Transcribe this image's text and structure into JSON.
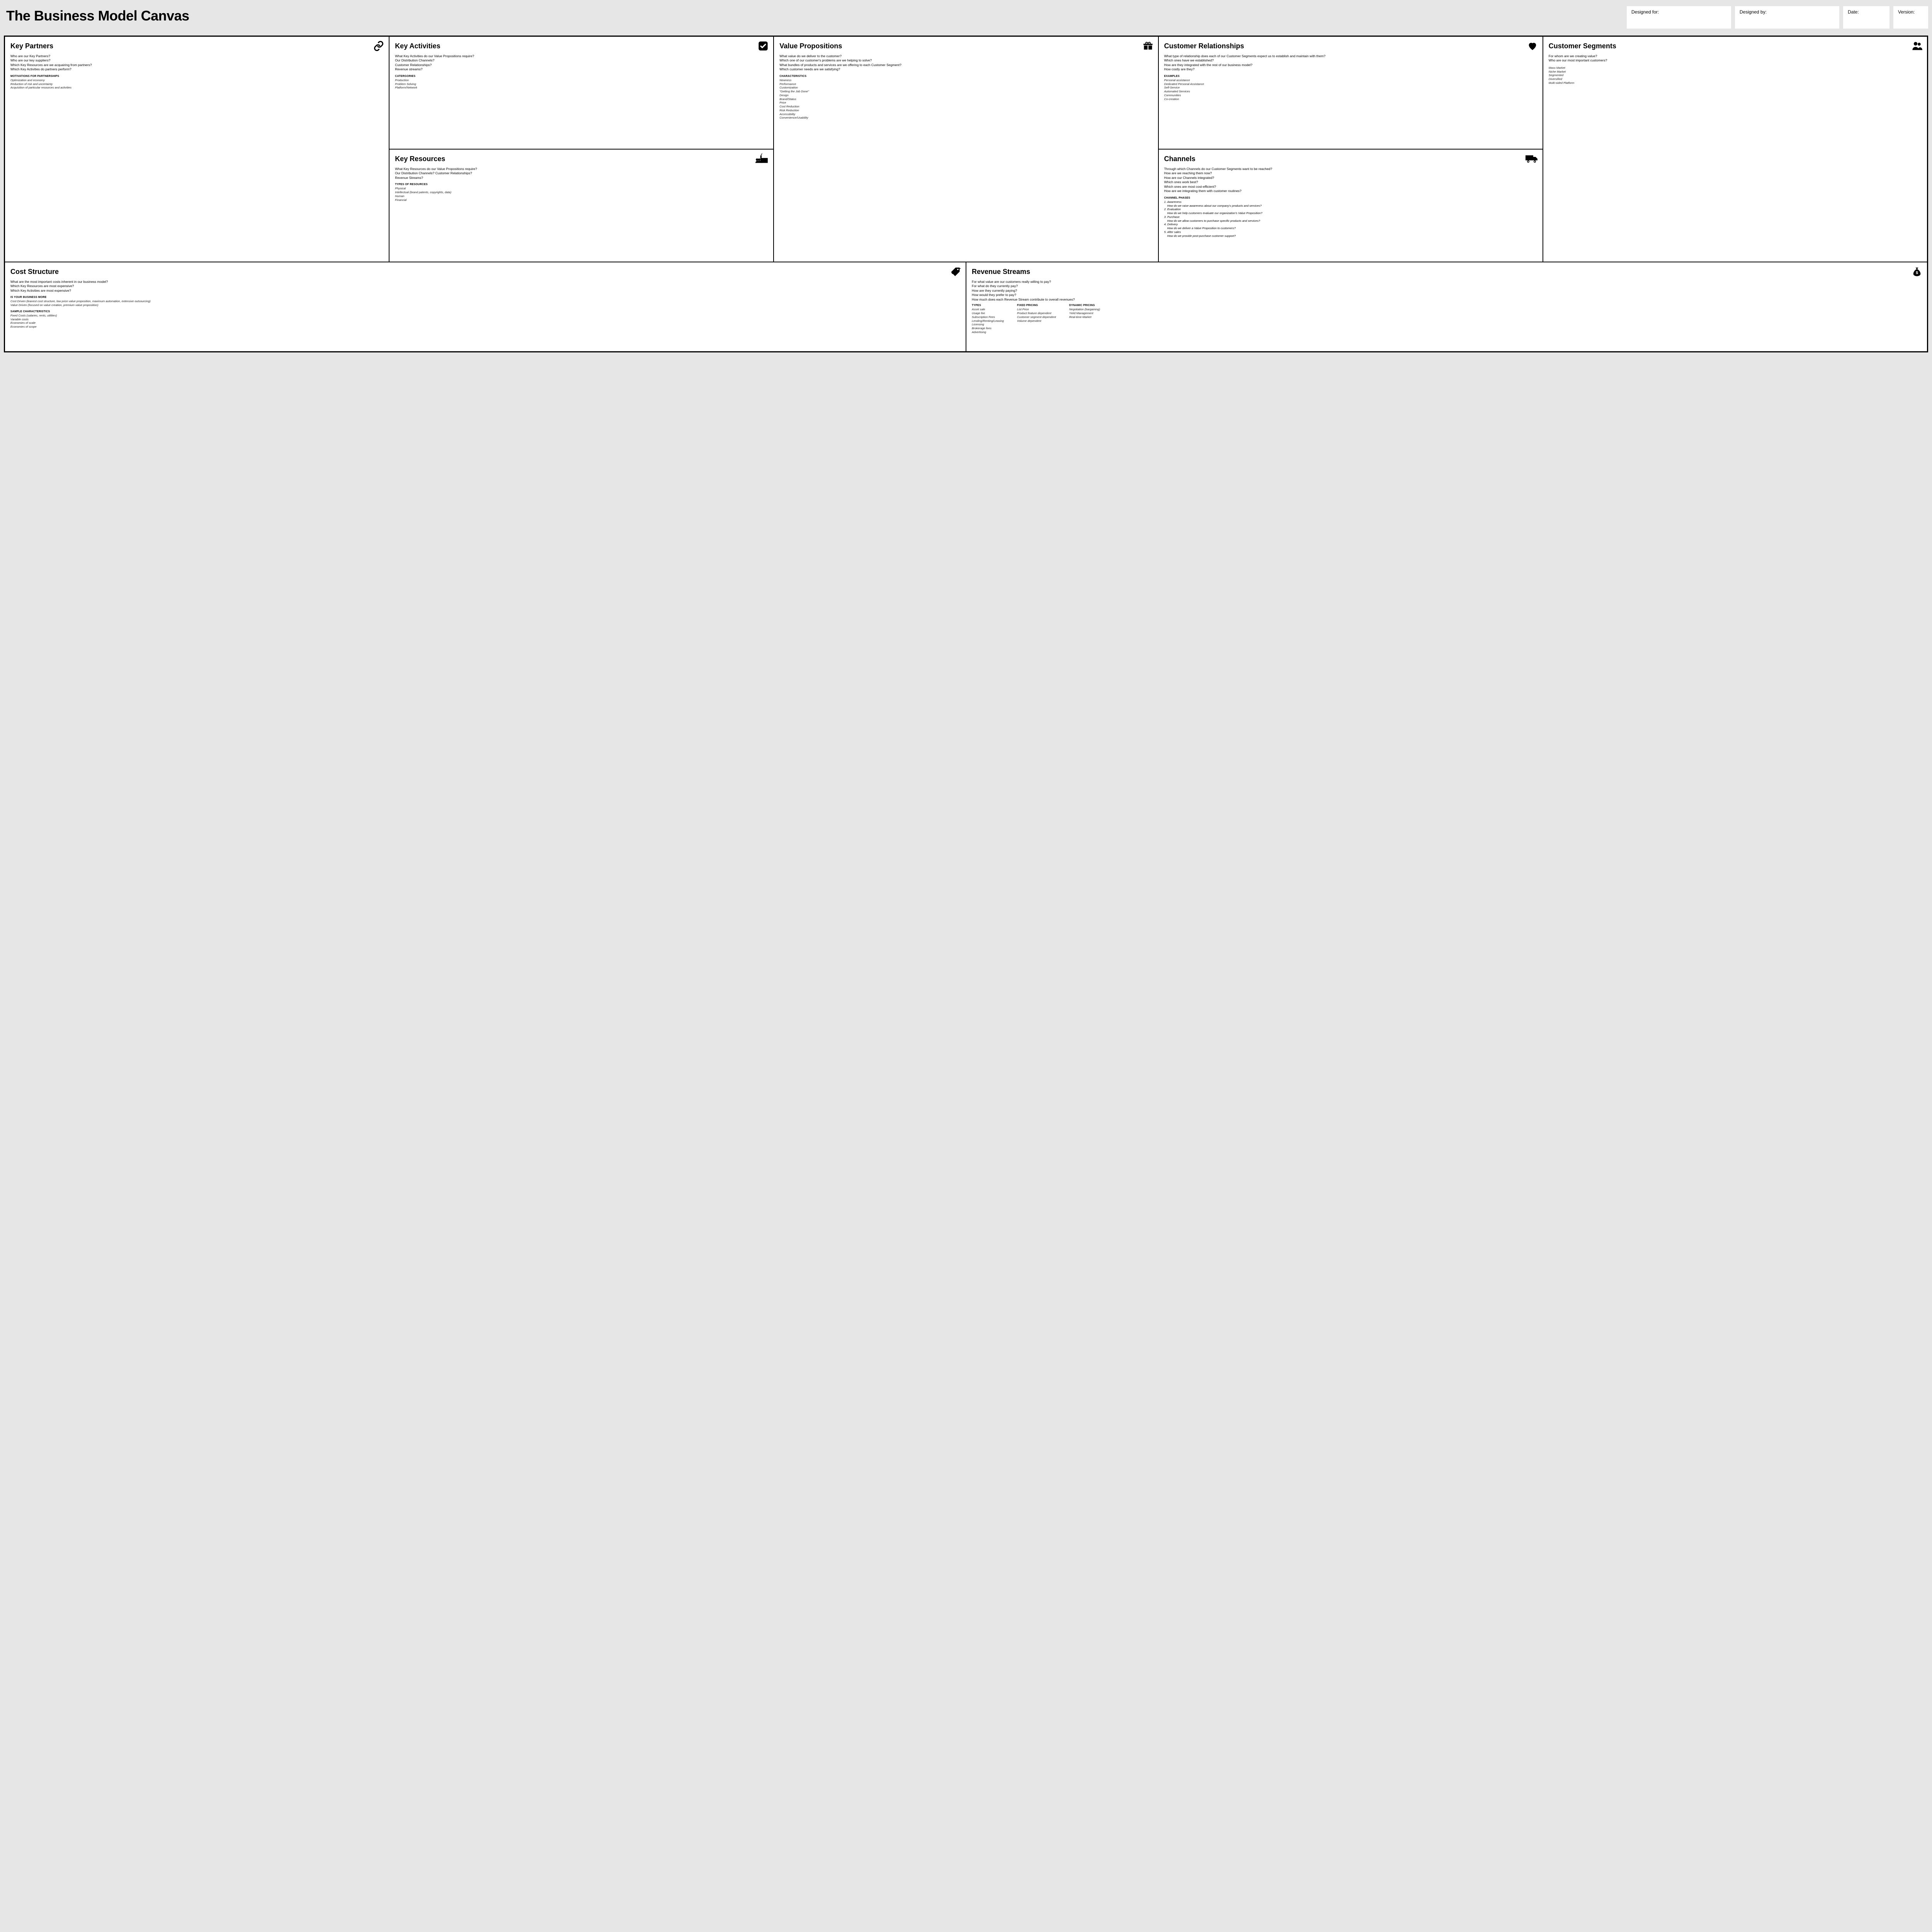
{
  "header": {
    "title": "The Business Model Canvas",
    "designed_for": "Designed for:",
    "designed_by": "Designed by:",
    "date": "Date:",
    "version": "Version:"
  },
  "kp": {
    "title": "Key Partners",
    "q1": "Who are our Key Partners?",
    "q2": "Who are our key suppliers?",
    "q3": "Which Key Resources are we acquairing from partners?",
    "q4": "Which Key Activities do partners perform?",
    "sub": "motivations for partnerships",
    "i1": "Optimization and economy",
    "i2": "Reduction of risk and uncertainty",
    "i3": "Acquisition of particular resources and activities"
  },
  "ka": {
    "title": "Key Activities",
    "q1": "What Key Activities do our Value Propositions require?",
    "q2": "Our Distribution Channels?",
    "q3": "Customer Relationships?",
    "q4": "Revenue streams?",
    "sub": "catergories",
    "i1": "Production",
    "i2": "Problem Solving",
    "i3": "Platform/Network"
  },
  "kr": {
    "title": "Key Resources",
    "q1": "What Key Resources do our Value Propositions require?",
    "q2": "Our Distribution Channels? Customer Relationships?",
    "q3": "Revenue Streams?",
    "sub": "types of resources",
    "i1": "Physical",
    "i2": "Intellectual (brand patents, copyrights, data)",
    "i3": "Human",
    "i4": "Financial"
  },
  "vp": {
    "title": "Value Propositions",
    "q1": "What value do we deliver to the customer?",
    "q2": "Which one of our customer's problems are we helping to solve?",
    "q3": "What bundles of products and services are we offering to each Customer Segment?",
    "q4": "Which customer needs are we satisfying?",
    "sub": "characteristics",
    "i1": "Newness",
    "i2": "Performance",
    "i3": "Customization",
    "i4": "\"Getting the Job Done\"",
    "i5": "Design",
    "i6": "Brand/Status",
    "i7": "Price",
    "i8": "Cost Reduction",
    "i9": "Risk Reduction",
    "i10": "Accessibility",
    "i11": "Convenience/Usability"
  },
  "cr": {
    "title": "Customer Relationships",
    "q1": "What type of relationship does each of our Customer Segments expect us to establish and maintain with them?",
    "q2": "Which ones have we established?",
    "q3": "How are they integrated with the rest of our business model?",
    "q4": "How costly are they?",
    "sub": "examples",
    "i1": "Personal assistance",
    "i2": "Dedicated Personal Assistance",
    "i3": "Self-Service",
    "i4": "Automated Services",
    "i5": "Communities",
    "i6": "Co-creation"
  },
  "ch": {
    "title": "Channels",
    "q1": "Through which Channels do our Customer Segments want to be reached?",
    "q2": "How are we reaching them now?",
    "q3": "How are our Channels integrated?",
    "q4": "Which ones work best?",
    "q5": "Which ones are most cost-efficient?",
    "q6": "How are we integrating them with customer routines?",
    "sub": "channel phases",
    "p1n": "1. Awareness",
    "p1t": "How do we raise awareness about our company's products and services?",
    "p2n": "2. Evaluation",
    "p2t": "How do we help customers evaluate our organization's Value Proposition?",
    "p3n": "3. Purchase",
    "p3t": "How do we allow customers to purchase specific products and services?",
    "p4n": "4. Delivery",
    "p4t": "How do we deliver a Value Proposition to customers?",
    "p5n": "5. After sales",
    "p5t": "How do we provide post-purchase customer support?"
  },
  "cs": {
    "title": "Customer Segments",
    "q1": "For whom are we creating value?",
    "q2": "Who are our most important customers?",
    "i1": "Mass Market",
    "i2": "Niche Market",
    "i3": "Segmented",
    "i4": "Diversified",
    "i5": "Multi-sided Platform"
  },
  "cost": {
    "title": "Cost Structure",
    "q1": "What are the most important costs inherent in our business model?",
    "q2": "Which Key Resources are most expensive?",
    "q3": "Which Key Activities are most expensive?",
    "sub1": "is your business more",
    "i1": "Cost Driven (leanest cost structure, low price value proposition, maximum automation, extensive outsourcing)",
    "i2": "Value Driven (focused on value creation, premium value proposition)",
    "sub2": "sample characteristics",
    "i3": "Fixed Costs (salaries, rents, utilities)",
    "i4": "Variable costs",
    "i5": "Economies of scale",
    "i6": "Economies of scope"
  },
  "rev": {
    "title": "Revenue Streams",
    "q1": "For what value are our customers really willing to pay?",
    "q2": "For what do they currently pay?",
    "q3": "How are they currently paying?",
    "q4": "How would they prefer to pay?",
    "q5": "How much does each Revenue Stream contribute to overall revenues?",
    "sub_types": "types",
    "t1": "Asset sale",
    "t2": "Usage fee",
    "t3": "Subscription Fees",
    "t4": "Lending/Renting/Leasing",
    "t5": "Licensing",
    "t6": "Brokerage fees",
    "t7": "Advertising",
    "sub_fixed": "fixed pricing",
    "f1": "List Price",
    "f2": "Product feature dependent",
    "f3": "Customer segment dependent",
    "f4": "Volume dependent",
    "sub_dyn": "dynamic pricing",
    "d1": "Negotiation (bargaining)",
    "d2": "Yield Management",
    "d3": "Real-time-Market"
  }
}
